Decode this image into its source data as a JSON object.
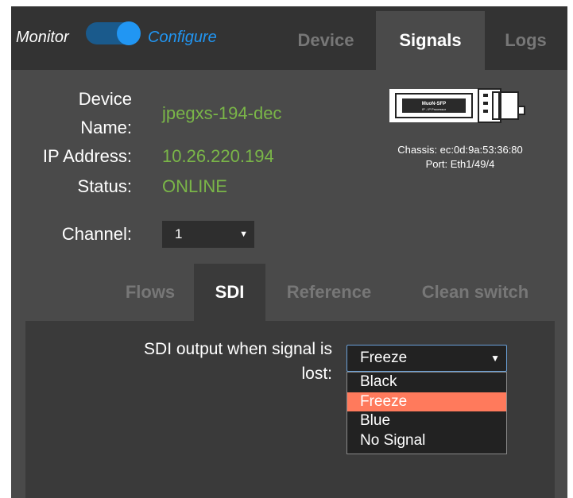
{
  "header": {
    "mode_left": "Monitor",
    "mode_right": "Configure",
    "tabs": [
      {
        "label": "Device"
      },
      {
        "label": "Signals"
      },
      {
        "label": "Logs"
      }
    ]
  },
  "device": {
    "name_label_1": "Device",
    "name_label_2": "Name:",
    "name_value": "jpegxs-194-dec",
    "ip_label": "IP Address:",
    "ip_value": "10.26.220.194",
    "status_label": "Status:",
    "status_value": "ONLINE",
    "sfp_brand": "MuoN-SFP",
    "sfp_sub": "IP - IP Processor",
    "chassis": "Chassis: ec:0d:9a:53:36:80",
    "port": "Port: Eth1/49/4"
  },
  "channel": {
    "label": "Channel:",
    "value": "1"
  },
  "subtabs": [
    {
      "label": "Flows"
    },
    {
      "label": "SDI"
    },
    {
      "label": "Reference"
    },
    {
      "label": "Clean switch"
    }
  ],
  "sdi": {
    "label_line1": "SDI output when signal is",
    "label_line2": "lost:",
    "selected": "Freeze",
    "options": [
      "Black",
      "Freeze",
      "Blue",
      "No Signal"
    ]
  },
  "colors": {
    "accent_blue": "#2196f3",
    "value_green": "#7ab648",
    "highlight": "#ff7a5c"
  }
}
